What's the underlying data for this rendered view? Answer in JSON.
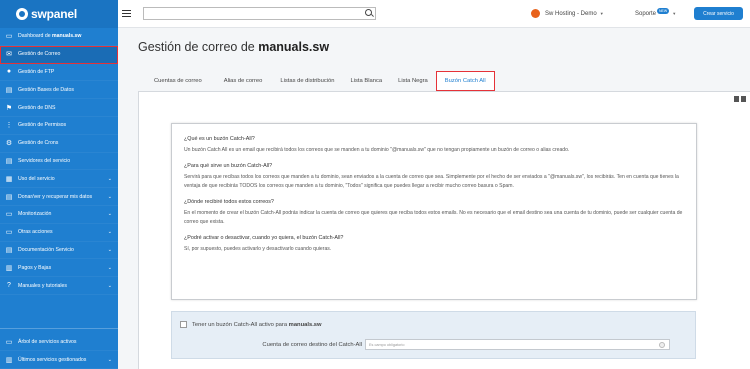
{
  "brand": {
    "name": "swpanel"
  },
  "sidebar": {
    "items": [
      {
        "label_pre": "Dashboard de ",
        "label_bold": "manuals.sw"
      },
      {
        "label": "Gestión de Correo"
      },
      {
        "label": "Gestión de FTP"
      },
      {
        "label": "Gestión Bases de Datos"
      },
      {
        "label": "Gestión de DNS"
      },
      {
        "label": "Gestión de Permisos"
      },
      {
        "label": "Gestión de Crons"
      },
      {
        "label": "Servidores del servicio"
      },
      {
        "label": "Uso del servicio"
      },
      {
        "label": "Donar/ver y recuperar mis datos"
      },
      {
        "label": "Monitorización"
      },
      {
        "label": "Otras acciones"
      },
      {
        "label": "Documentación Servicio"
      },
      {
        "label": "Pagos y Bajas"
      },
      {
        "label": "Manuales y tutoriales"
      }
    ],
    "bottom": [
      {
        "label": "Árbol de servicios activos"
      },
      {
        "label": "Últimos servicios gestionados"
      }
    ]
  },
  "topbar": {
    "search_placeholder": "",
    "account": "Sw Hosting - Demo",
    "support": "Soporte",
    "support_badge": "NEW",
    "create_button": "Crear servicio"
  },
  "page": {
    "title_pre": "Gestión de correo de ",
    "title_bold": "manuals.sw"
  },
  "tabs": [
    "Cuentas de correo",
    "Alias de correo",
    "Listas de distribución",
    "Lista Blanca",
    "Lista Negra",
    "Buzón Catch All"
  ],
  "info": {
    "q1": "¿Qué es un buzón Catch-All?",
    "a1": "Un buzón Catch All es un email que recibirá todos los correos que se manden a tu dominio \"@manuals.sw\" que no tengan propiamente un buzón de correo o alias creado.",
    "q2": "¿Para qué sirve un buzón Catch-All?",
    "a2": "Servirá para que recibas todos los correos que manden a tu dominio, sean enviados a la cuenta de correo que sea. Simplemente por el hecho de ser enviados a \"@manuals.sw\", los recibirás. Ten en cuenta que tienes la ventaja de que recibirás TODOS los correos que manden a tu dominio, \"Todos\" significa que puedes llegar a recibir mucho correo basura o Spam.",
    "q3": "¿Dónde recibiré todos estos correos?",
    "a3": "En el momento de crear el buzón Catch-All podrás indicar la cuenta de correo que quieres que reciba todos estos emails. No es necesario que el email destino sea una cuenta de tu dominio, puede ser cualquier cuenta de correo que exista.",
    "q4": "¿Podré activar o desactivar, cuando yo quiera, el buzón Catch-All?",
    "a4": "Sí, por supuesto, puedes activarlo y desactivarlo cuando quieras."
  },
  "setting": {
    "checkbox_label_pre": "Tener un buzón Catch-All activo para ",
    "checkbox_label_bold": "manuals.sw",
    "dest_label": "Cuenta de correo destino del Catch-All",
    "dest_placeholder": "Es campo obligatorio"
  }
}
